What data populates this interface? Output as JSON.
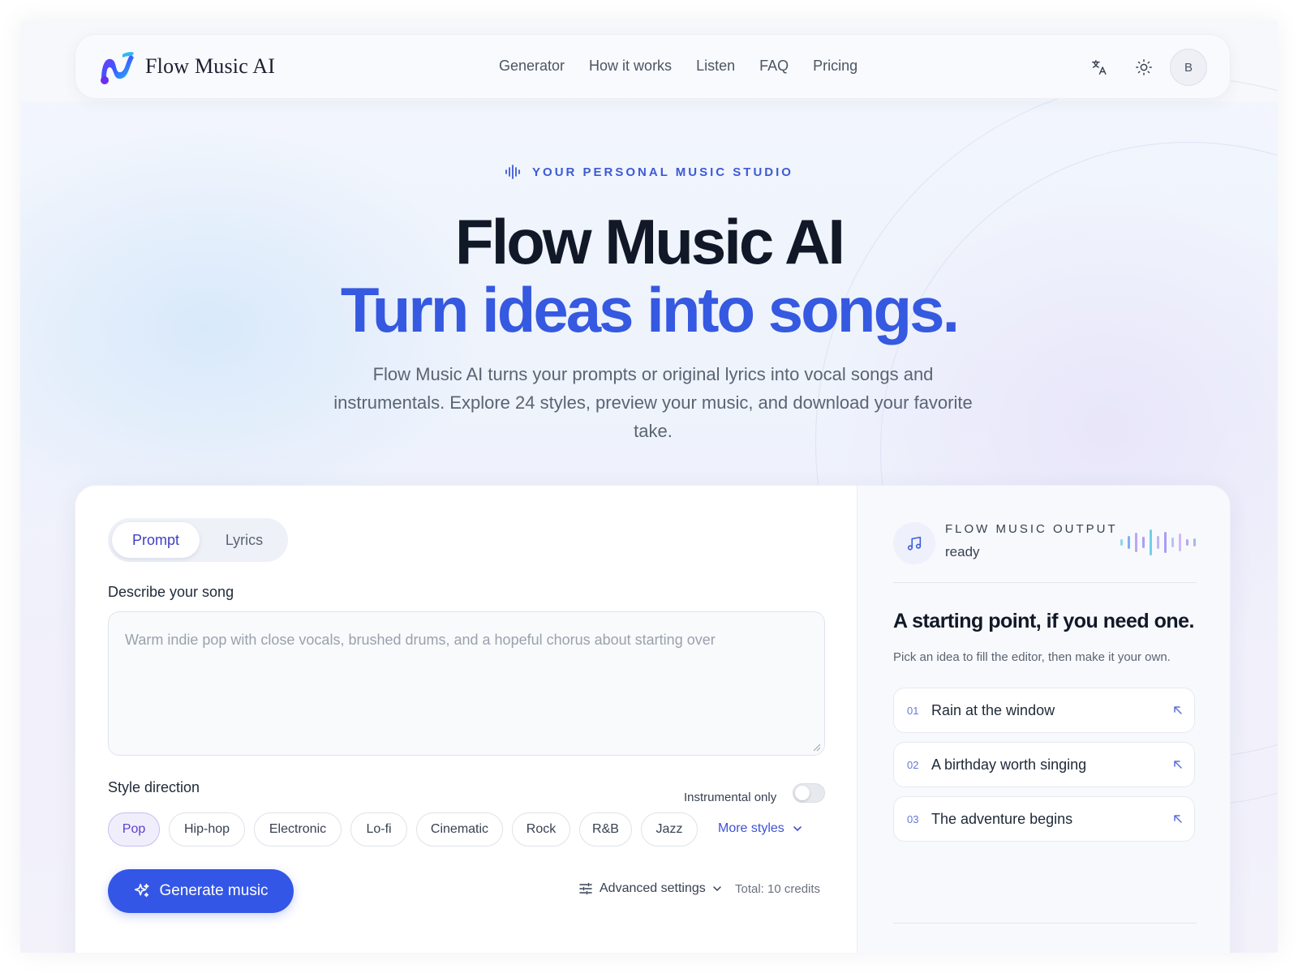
{
  "nav": {
    "brand": "Flow Music AI",
    "links": [
      "Generator",
      "How it works",
      "Listen",
      "FAQ",
      "Pricing"
    ],
    "avatar_initial": "B",
    "icons": [
      "translate-icon",
      "sun-icon"
    ]
  },
  "hero": {
    "eyebrow": "YOUR PERSONAL MUSIC STUDIO",
    "title": "Flow Music AI",
    "subtitle": "Turn ideas into songs.",
    "description": "Flow Music AI turns your prompts or original lyrics into vocal songs and instrumentals. Explore 24 styles, preview your music, and download your favorite take."
  },
  "editor": {
    "tabs": [
      "Prompt",
      "Lyrics"
    ],
    "active_tab": "Prompt",
    "describe_label": "Describe your song",
    "describe_placeholder": "Warm indie pop with close vocals, brushed drums, and a hopeful chorus about starting over",
    "describe_value": "",
    "style_label": "Style direction",
    "instrumental_label": "Instrumental only",
    "instrumental_on": false,
    "styles": [
      "Pop",
      "Hip-hop",
      "Electronic",
      "Lo-fi",
      "Cinematic",
      "Rock",
      "R&B",
      "Jazz"
    ],
    "selected_style": "Pop",
    "more_styles": "More styles",
    "generate_label": "Generate music",
    "advanced_label": "Advanced settings",
    "credits": "Total: 10 credits"
  },
  "output": {
    "title": "FLOW MUSIC OUTPUT",
    "status": "ready",
    "starting_title": "A starting point, if you need one.",
    "starting_sub": "Pick an idea to fill the editor, then make it your own.",
    "ideas": [
      {
        "num": "01",
        "text": "Rain at the window"
      },
      {
        "num": "02",
        "text": "A birthday worth singing"
      },
      {
        "num": "03",
        "text": "The adventure begins"
      }
    ]
  },
  "colors": {
    "accent": "#3456e6",
    "accent_text": "#3559e0",
    "chip_active": "#5b3fd0"
  }
}
